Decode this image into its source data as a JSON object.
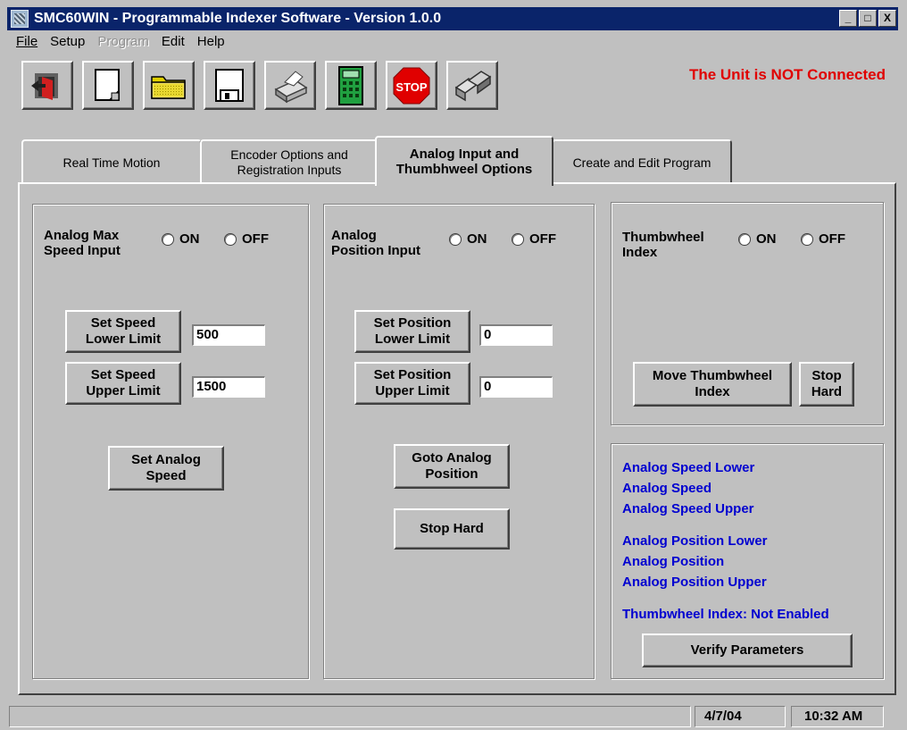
{
  "window": {
    "title": "SMC60WIN - Programmable Indexer Software - Version 1.0.0",
    "min": "_",
    "max": "□",
    "close": "X"
  },
  "menu": [
    "File",
    "Setup",
    "Program",
    "Edit",
    "Help"
  ],
  "toolbar": {
    "icons": [
      "exit-icon",
      "new-file-icon",
      "open-folder-icon",
      "save-disk-icon",
      "print-icon",
      "calculator-icon",
      "stop-icon",
      "connect-icon"
    ],
    "stop_text": "STOP"
  },
  "connection_status": "The Unit is NOT Connected",
  "tabs": {
    "real_time": "Real Time Motion",
    "encoder": "Encoder Options and Registration Inputs",
    "analog": "Analog Input and Thumbhweel Options",
    "program": "Create and Edit Program"
  },
  "speed": {
    "label": "Analog Max Speed Input",
    "on": "ON",
    "off": "OFF",
    "lower_btn": "Set Speed Lower Limit",
    "lower_val": "500",
    "upper_btn": "Set Speed Upper Limit",
    "upper_val": "1500",
    "set_btn": "Set Analog Speed"
  },
  "position": {
    "label": "Analog Position Input",
    "on": "ON",
    "off": "OFF",
    "lower_btn": "Set Position Lower Limit",
    "lower_val": "0",
    "upper_btn": "Set Position Upper Limit",
    "upper_val": "0",
    "goto_btn": "Goto Analog Position",
    "stop_btn": "Stop Hard"
  },
  "thumbwheel": {
    "label": "Thumbwheel Index",
    "on": "ON",
    "off": "OFF",
    "move_btn": "Move Thumbwheel Index",
    "stop_btn": "Stop Hard"
  },
  "info": {
    "speed_lower": "Analog Speed Lower",
    "speed": "Analog Speed",
    "speed_upper": "Analog Speed Upper",
    "pos_lower": "Analog Position Lower",
    "pos": "Analog Position",
    "pos_upper": "Analog Position Upper",
    "thumbwheel": "Thumbwheel Index: Not Enabled",
    "verify_btn": "Verify Parameters"
  },
  "statusbar": {
    "date": "4/7/04",
    "time": "10:32 AM"
  },
  "colors": {
    "titlebar": "#0a246a",
    "status_red": "#e00000",
    "info_blue": "#0000d0",
    "face": "#c0c0c0"
  }
}
